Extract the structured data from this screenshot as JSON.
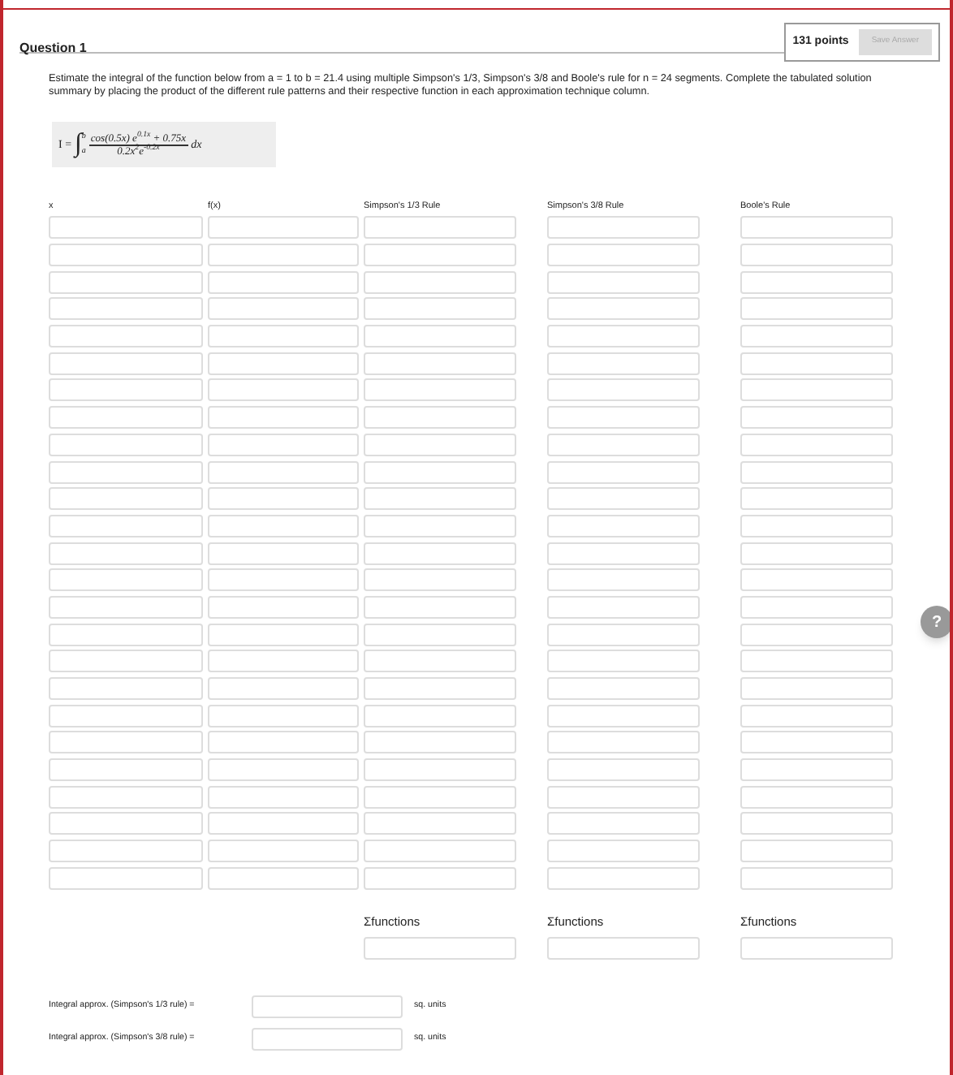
{
  "question": {
    "title": "Question 1",
    "points": "131 points",
    "save_button": "Save Answer",
    "prompt": "Estimate the integral of the function below from a = 1 to b = 21.4 using multiple Simpson's 1/3, Simpson's 3/8 and Boole's rule for n = 24 segments. Complete the tabulated solution summary by placing the product of the different rule patterns and their respective function in each approximation technique column."
  },
  "formula": {
    "lhs": "I =",
    "integral": "∫",
    "upper": "b",
    "lower": "a",
    "numerator": "cos(0.5x) e$^{0.1x}$ + 0.75x",
    "denominator": "0.2x$^{2}$e$^{-0.2x}$",
    "differential": "dx"
  },
  "table": {
    "columns": [
      {
        "label": "x"
      },
      {
        "label": "f(x)"
      },
      {
        "label": "Simpson's 1/3 Rule",
        "sum_label": "Σfunctions"
      },
      {
        "label": "Simpson's 3/8 Rule",
        "sum_label": "Σfunctions"
      },
      {
        "label": "Boole's Rule",
        "sum_label": "Σfunctions"
      }
    ]
  },
  "integrals": [
    {
      "label": "Integral approx. (Simpson's 1/3 rule) =",
      "unit": "sq. units"
    },
    {
      "label": "Integral approx. (Simpson's 3/8 rule) =",
      "unit": "sq. units"
    }
  ],
  "help_button": "?"
}
